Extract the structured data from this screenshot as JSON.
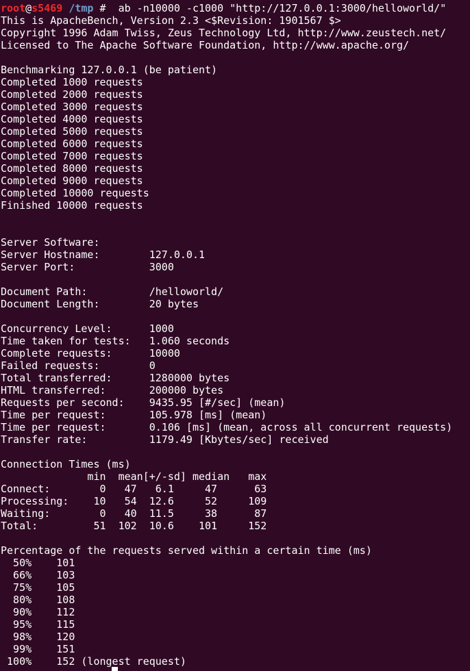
{
  "terminal": {
    "partial_top_line": " (        [         )",
    "prompt": {
      "user": "root",
      "at": "@",
      "host": "s5469",
      "path": " /tmp",
      "symbol": " #",
      "command": "  ab -n10000 -c1000 \"http://127.0.0.1:3000/helloworld/\""
    },
    "lines": [
      "This is ApacheBench, Version 2.3 <$Revision: 1901567 $>",
      "Copyright 1996 Adam Twiss, Zeus Technology Ltd, http://www.zeustech.net/",
      "Licensed to The Apache Software Foundation, http://www.apache.org/",
      "",
      "Benchmarking 127.0.0.1 (be patient)",
      "Completed 1000 requests",
      "Completed 2000 requests",
      "Completed 3000 requests",
      "Completed 4000 requests",
      "Completed 5000 requests",
      "Completed 6000 requests",
      "Completed 7000 requests",
      "Completed 8000 requests",
      "Completed 9000 requests",
      "Completed 10000 requests",
      "Finished 10000 requests",
      "",
      "",
      "Server Software:",
      "Server Hostname:        127.0.0.1",
      "Server Port:            3000",
      "",
      "Document Path:          /helloworld/",
      "Document Length:        20 bytes",
      "",
      "Concurrency Level:      1000",
      "Time taken for tests:   1.060 seconds",
      "Complete requests:      10000",
      "Failed requests:        0",
      "Total transferred:      1280000 bytes",
      "HTML transferred:       200000 bytes",
      "Requests per second:    9435.95 [#/sec] (mean)",
      "Time per request:       105.978 [ms] (mean)",
      "Time per request:       0.106 [ms] (mean, across all concurrent requests)",
      "Transfer rate:          1179.49 [Kbytes/sec] received",
      "",
      "Connection Times (ms)",
      "              min  mean[+/-sd] median   max",
      "Connect:        0   47   6.1     47      63",
      "Processing:    10   54  12.6     52     109",
      "Waiting:        0   40  11.5     38      87",
      "Total:         51  102  10.6    101     152",
      "",
      "Percentage of the requests served within a certain time (ms)",
      "  50%    101",
      "  66%    103",
      "  75%    105",
      "  80%    108",
      "  90%    112",
      "  95%    115",
      "  98%    120",
      "  99%    151",
      " 100%    152 (longest request)"
    ]
  }
}
